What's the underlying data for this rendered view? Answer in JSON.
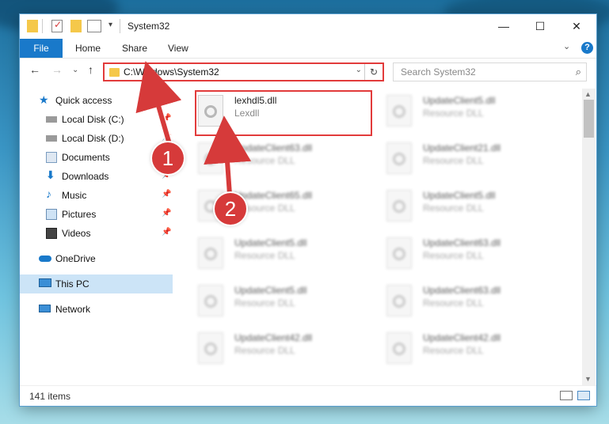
{
  "window": {
    "title": "System32",
    "controls": {
      "minimize": "—",
      "maximize": "☐",
      "close": "✕"
    }
  },
  "ribbon": {
    "file": "File",
    "tabs": [
      "Home",
      "Share",
      "View"
    ],
    "help": "?",
    "expand": "⌄"
  },
  "nav": {
    "back": "←",
    "forward": "→",
    "recent": "⌄",
    "up": "↑",
    "address": "C:\\Windows\\System32",
    "address_dropdown": "⌄",
    "refresh": "↻",
    "search_placeholder": "Search System32",
    "search_icon": "⌕"
  },
  "sidebar": {
    "items": [
      {
        "label": "Quick access",
        "icon": "star-icon",
        "pinned": false
      },
      {
        "label": "Local Disk (C:)",
        "icon": "drive-icon",
        "pinned": true
      },
      {
        "label": "Local Disk (D:)",
        "icon": "drive-icon",
        "pinned": true
      },
      {
        "label": "Documents",
        "icon": "documents-icon",
        "pinned": true
      },
      {
        "label": "Downloads",
        "icon": "download-icon",
        "pinned": true
      },
      {
        "label": "Music",
        "icon": "music-icon",
        "pinned": true
      },
      {
        "label": "Pictures",
        "icon": "pictures-icon",
        "pinned": true
      },
      {
        "label": "Videos",
        "icon": "videos-icon",
        "pinned": true
      },
      {
        "label": "OneDrive",
        "icon": "cloud-icon",
        "pinned": false
      },
      {
        "label": "This PC",
        "icon": "computer-icon",
        "pinned": false,
        "selected": true
      },
      {
        "label": "Network",
        "icon": "network-icon",
        "pinned": false
      }
    ],
    "pin_glyph": "📌"
  },
  "files": [
    {
      "name": "lexhdl5.dll",
      "type": "Lexdll",
      "highlighted": true
    },
    {
      "name": "UpdateClient5.dll",
      "type": "Resource DLL"
    },
    {
      "name": "UpdateClient63.dll",
      "type": "Resource DLL"
    },
    {
      "name": "UpdateClient21.dll",
      "type": "Resource DLL"
    },
    {
      "name": "UpdateClient65.dll",
      "type": "Resource DLL"
    },
    {
      "name": "UpdateClient5.dll",
      "type": "Resource DLL"
    },
    {
      "name": "UpdateClient5.dll",
      "type": "Resource DLL"
    },
    {
      "name": "UpdateClient63.dll",
      "type": "Resource DLL"
    },
    {
      "name": "UpdateClient5.dll",
      "type": "Resource DLL"
    },
    {
      "name": "UpdateClient63.dll",
      "type": "Resource DLL"
    },
    {
      "name": "UpdateClient42.dll",
      "type": "Resource DLL"
    },
    {
      "name": "UpdateClient42.dll",
      "type": "Resource DLL"
    }
  ],
  "status": {
    "count": "141 items"
  },
  "annotations": {
    "step1": "1",
    "step2": "2"
  },
  "colors": {
    "accent": "#1979ca",
    "highlight": "#e23b3b",
    "selected": "#cce4f7"
  }
}
